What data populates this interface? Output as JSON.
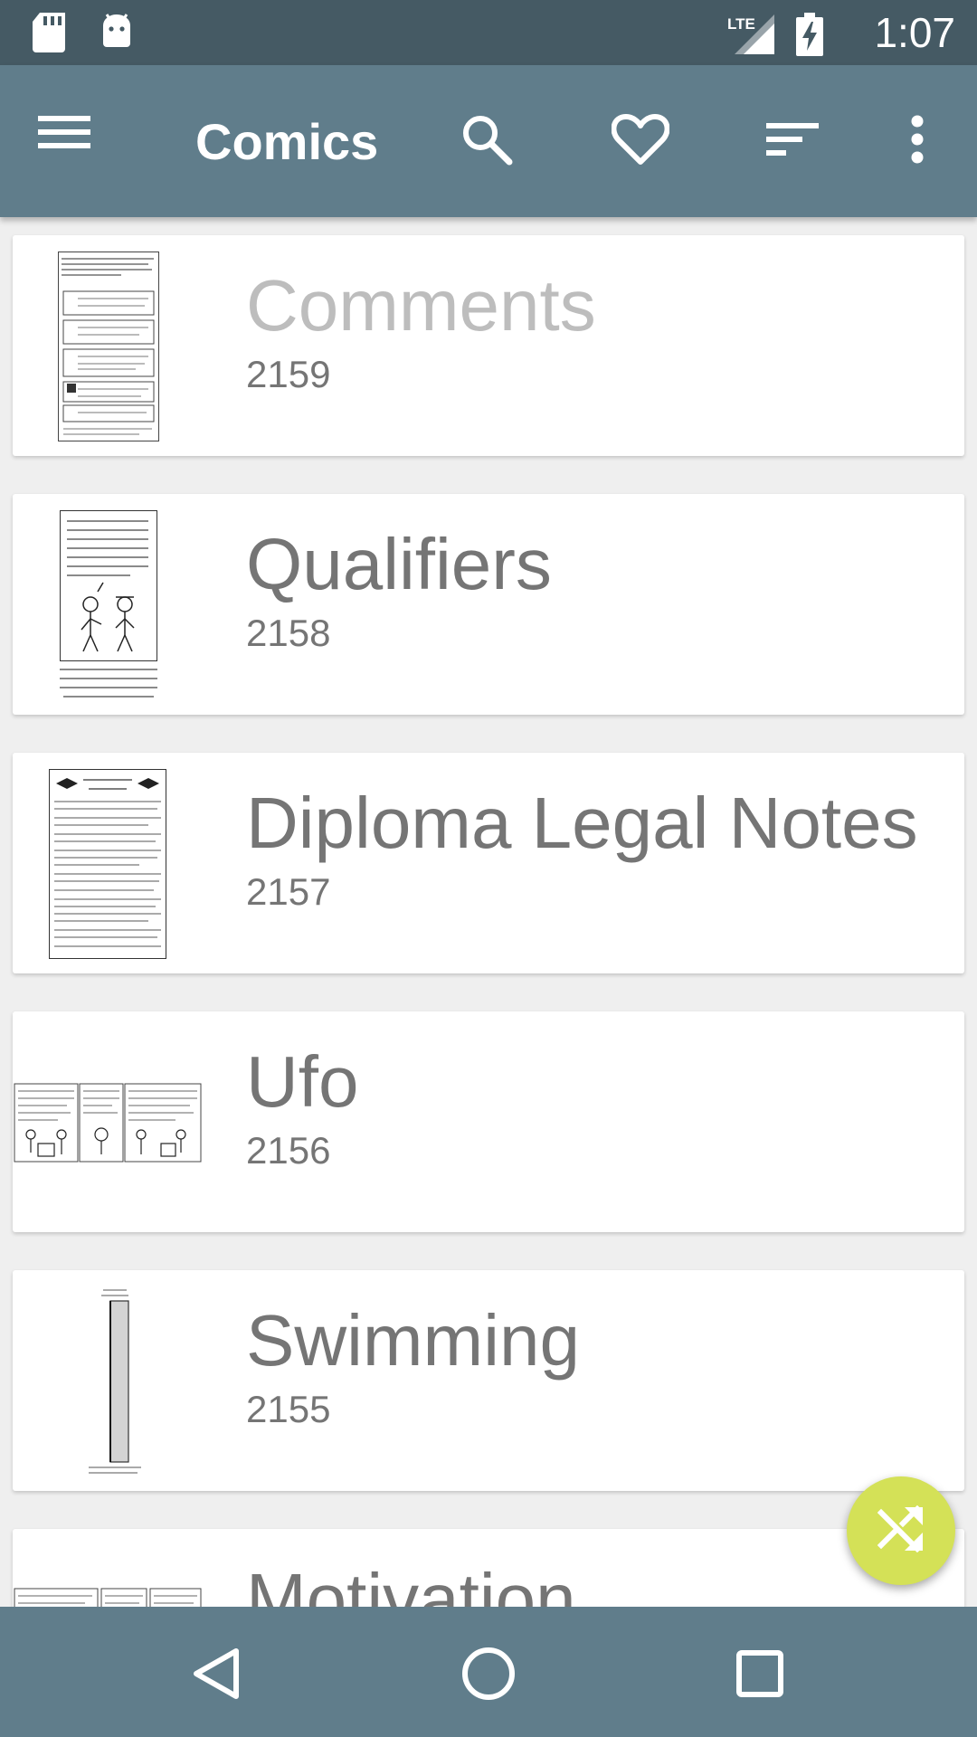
{
  "status_bar": {
    "time": "1:07",
    "network": "LTE",
    "icons": [
      "sd-card-icon",
      "android-icon",
      "lte-signal-icon",
      "battery-charging-icon"
    ]
  },
  "app_bar": {
    "title": "Comics",
    "actions": [
      "menu-icon",
      "search-icon",
      "heart-icon",
      "sort-icon",
      "more-vert-icon"
    ]
  },
  "comics": [
    {
      "title": "Comments",
      "number": "2159",
      "read": true
    },
    {
      "title": "Qualifiers",
      "number": "2158",
      "read": false
    },
    {
      "title": "Diploma Legal Notes",
      "number": "2157",
      "read": false
    },
    {
      "title": "Ufo",
      "number": "2156",
      "read": false
    },
    {
      "title": "Swimming",
      "number": "2155",
      "read": false
    },
    {
      "title": "Motivation",
      "number": "",
      "read": false
    }
  ],
  "fab": {
    "icon": "shuffle-icon"
  },
  "nav_bar": {
    "buttons": [
      "back-icon",
      "home-icon",
      "recents-icon"
    ]
  },
  "colors": {
    "status_bar": "#455a64",
    "app_bar": "#607d8b",
    "fab": "#d4e157",
    "title_text": "#757575",
    "read_title_text": "#bdbdbd"
  }
}
